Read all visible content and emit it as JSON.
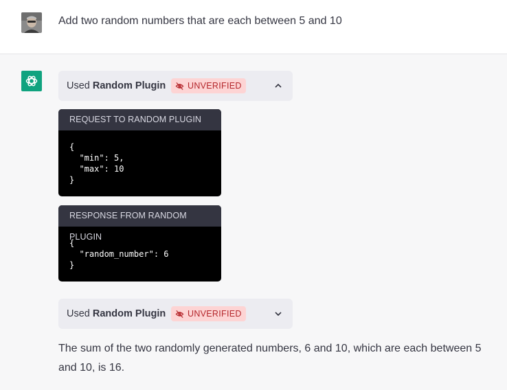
{
  "user_message": {
    "text": "Add two random numbers that are each between 5 and 10"
  },
  "assistant": {
    "plugin_calls": [
      {
        "used_prefix": "Used",
        "plugin_name": "Random Plugin",
        "badge": "UNVERIFIED",
        "expanded": true,
        "request_title": "REQUEST TO RANDOM PLUGIN",
        "request_code": "{\n  \"min\": 5,\n  \"max\": 10\n}",
        "response_title": "RESPONSE FROM RANDOM PLUGIN",
        "response_code": "{\n  \"random_number\": 6\n}"
      },
      {
        "used_prefix": "Used",
        "plugin_name": "Random Plugin",
        "badge": "UNVERIFIED",
        "expanded": false
      }
    ],
    "answer": "The sum of the two randomly generated numbers, 6 and 10, which are each between 5 and 10, is 16."
  },
  "colors": {
    "badge_bg": "#fdd4d4",
    "badge_text": "#b4262b",
    "assistant_icon": "#10a37f"
  },
  "icons": [
    "user-avatar",
    "openai-logo-icon",
    "eye-slash-icon",
    "chevron-up-icon",
    "chevron-down-icon"
  ]
}
